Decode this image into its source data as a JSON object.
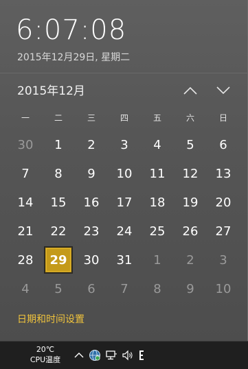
{
  "clock": {
    "time": "6:07:08",
    "date_long": "2015年12月29日, 星期二"
  },
  "calendar": {
    "month_title": "2015年12月",
    "weekdays": [
      "一",
      "二",
      "三",
      "四",
      "五",
      "六",
      "日"
    ],
    "days": [
      {
        "n": "30",
        "cur": false
      },
      {
        "n": "1",
        "cur": true
      },
      {
        "n": "2",
        "cur": true
      },
      {
        "n": "3",
        "cur": true
      },
      {
        "n": "4",
        "cur": true
      },
      {
        "n": "5",
        "cur": true
      },
      {
        "n": "6",
        "cur": true
      },
      {
        "n": "7",
        "cur": true
      },
      {
        "n": "8",
        "cur": true
      },
      {
        "n": "9",
        "cur": true
      },
      {
        "n": "10",
        "cur": true
      },
      {
        "n": "11",
        "cur": true
      },
      {
        "n": "12",
        "cur": true
      },
      {
        "n": "13",
        "cur": true
      },
      {
        "n": "14",
        "cur": true
      },
      {
        "n": "15",
        "cur": true
      },
      {
        "n": "16",
        "cur": true
      },
      {
        "n": "17",
        "cur": true
      },
      {
        "n": "18",
        "cur": true
      },
      {
        "n": "19",
        "cur": true
      },
      {
        "n": "20",
        "cur": true
      },
      {
        "n": "21",
        "cur": true
      },
      {
        "n": "22",
        "cur": true
      },
      {
        "n": "23",
        "cur": true
      },
      {
        "n": "24",
        "cur": true
      },
      {
        "n": "25",
        "cur": true
      },
      {
        "n": "26",
        "cur": true
      },
      {
        "n": "27",
        "cur": true
      },
      {
        "n": "28",
        "cur": true
      },
      {
        "n": "29",
        "cur": true,
        "today": true
      },
      {
        "n": "30",
        "cur": true
      },
      {
        "n": "31",
        "cur": true
      },
      {
        "n": "1",
        "cur": false
      },
      {
        "n": "2",
        "cur": false
      },
      {
        "n": "3",
        "cur": false
      },
      {
        "n": "4",
        "cur": false
      },
      {
        "n": "5",
        "cur": false
      },
      {
        "n": "6",
        "cur": false
      },
      {
        "n": "7",
        "cur": false
      },
      {
        "n": "8",
        "cur": false
      },
      {
        "n": "9",
        "cur": false
      },
      {
        "n": "10",
        "cur": false
      }
    ],
    "nav_icons": {
      "up": "chevron-up-icon",
      "down": "chevron-down-icon"
    }
  },
  "settings_link": "日期和时间设置",
  "taskbar": {
    "cpu_temp": "20℃",
    "cpu_label": "CPU温度",
    "tray_icons": [
      "chevron-up-icon",
      "network-globe-icon",
      "network-monitor-icon",
      "volume-icon",
      "ime-icon"
    ]
  },
  "colors": {
    "accent_today": "#c49a1a",
    "link": "#f0c33c",
    "other_month_text": "#9a9a9a"
  }
}
